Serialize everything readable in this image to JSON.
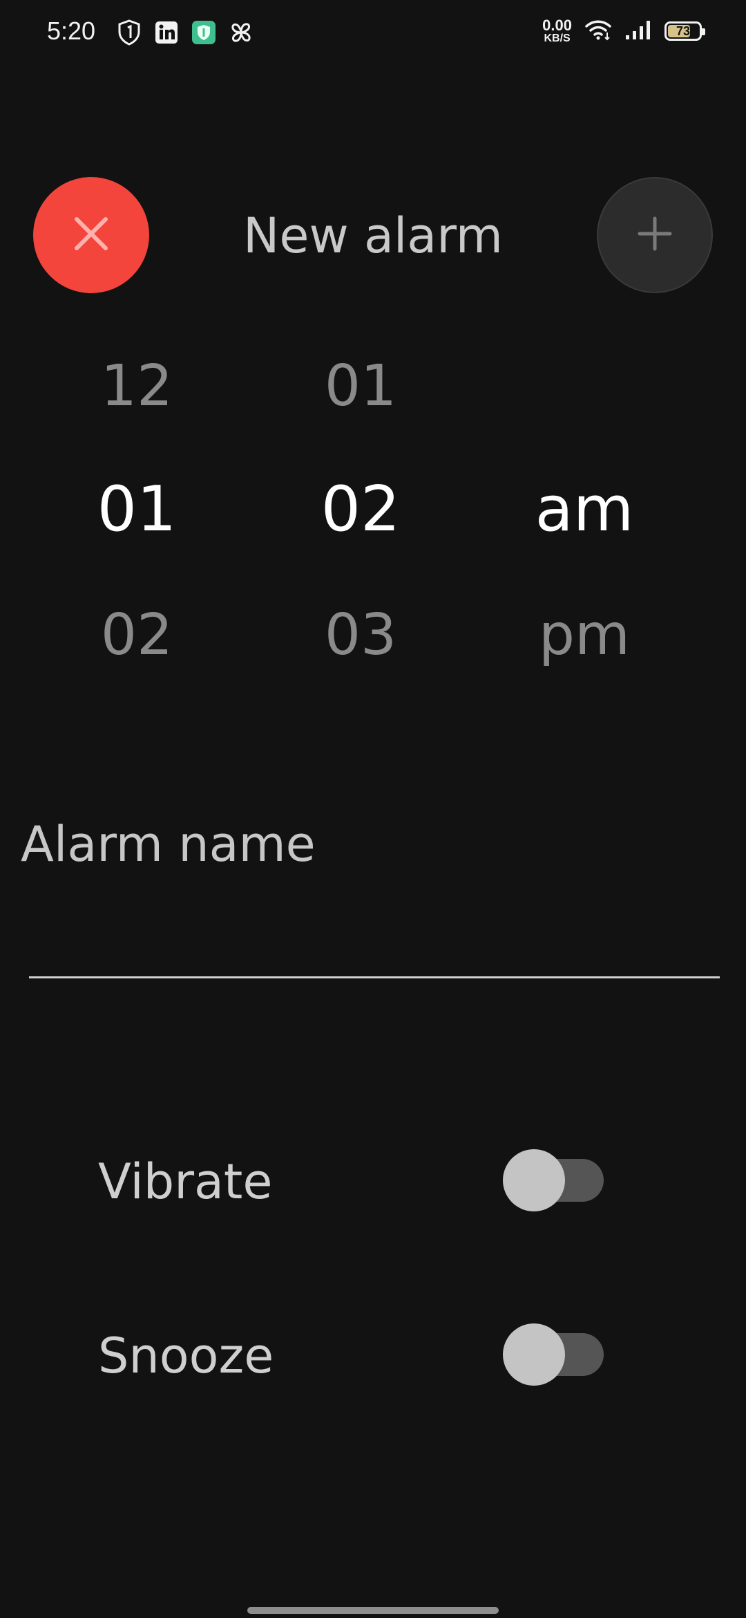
{
  "status_bar": {
    "time": "5:20",
    "net_speed_value": "0.00",
    "net_speed_unit": "KB/S",
    "battery_level": "73",
    "battery_fraction": 0.73,
    "icons": [
      "shield-1-icon",
      "linkedin-icon",
      "vpn-shield-icon",
      "pinwheel-icon",
      "wifi-icon",
      "signal-icon",
      "battery-icon"
    ],
    "colors": {
      "battery_fill": "#d7c38a"
    }
  },
  "header": {
    "title": "New alarm",
    "close_icon": "close-icon",
    "add_icon": "plus-icon",
    "colors": {
      "close_bg": "#f4453c",
      "add_bg": "#2c2c2c"
    }
  },
  "picker": {
    "hours": {
      "prev": "12",
      "selected": "01",
      "next": "02"
    },
    "minutes": {
      "prev": "01",
      "selected": "02",
      "next": "03"
    },
    "period": {
      "selected": "am",
      "next": "pm"
    }
  },
  "alarm_name": {
    "label": "Alarm name",
    "value": "",
    "placeholder": ""
  },
  "settings": {
    "vibrate": {
      "label": "Vibrate",
      "enabled": false
    },
    "snooze": {
      "label": "Snooze",
      "enabled": false
    }
  }
}
